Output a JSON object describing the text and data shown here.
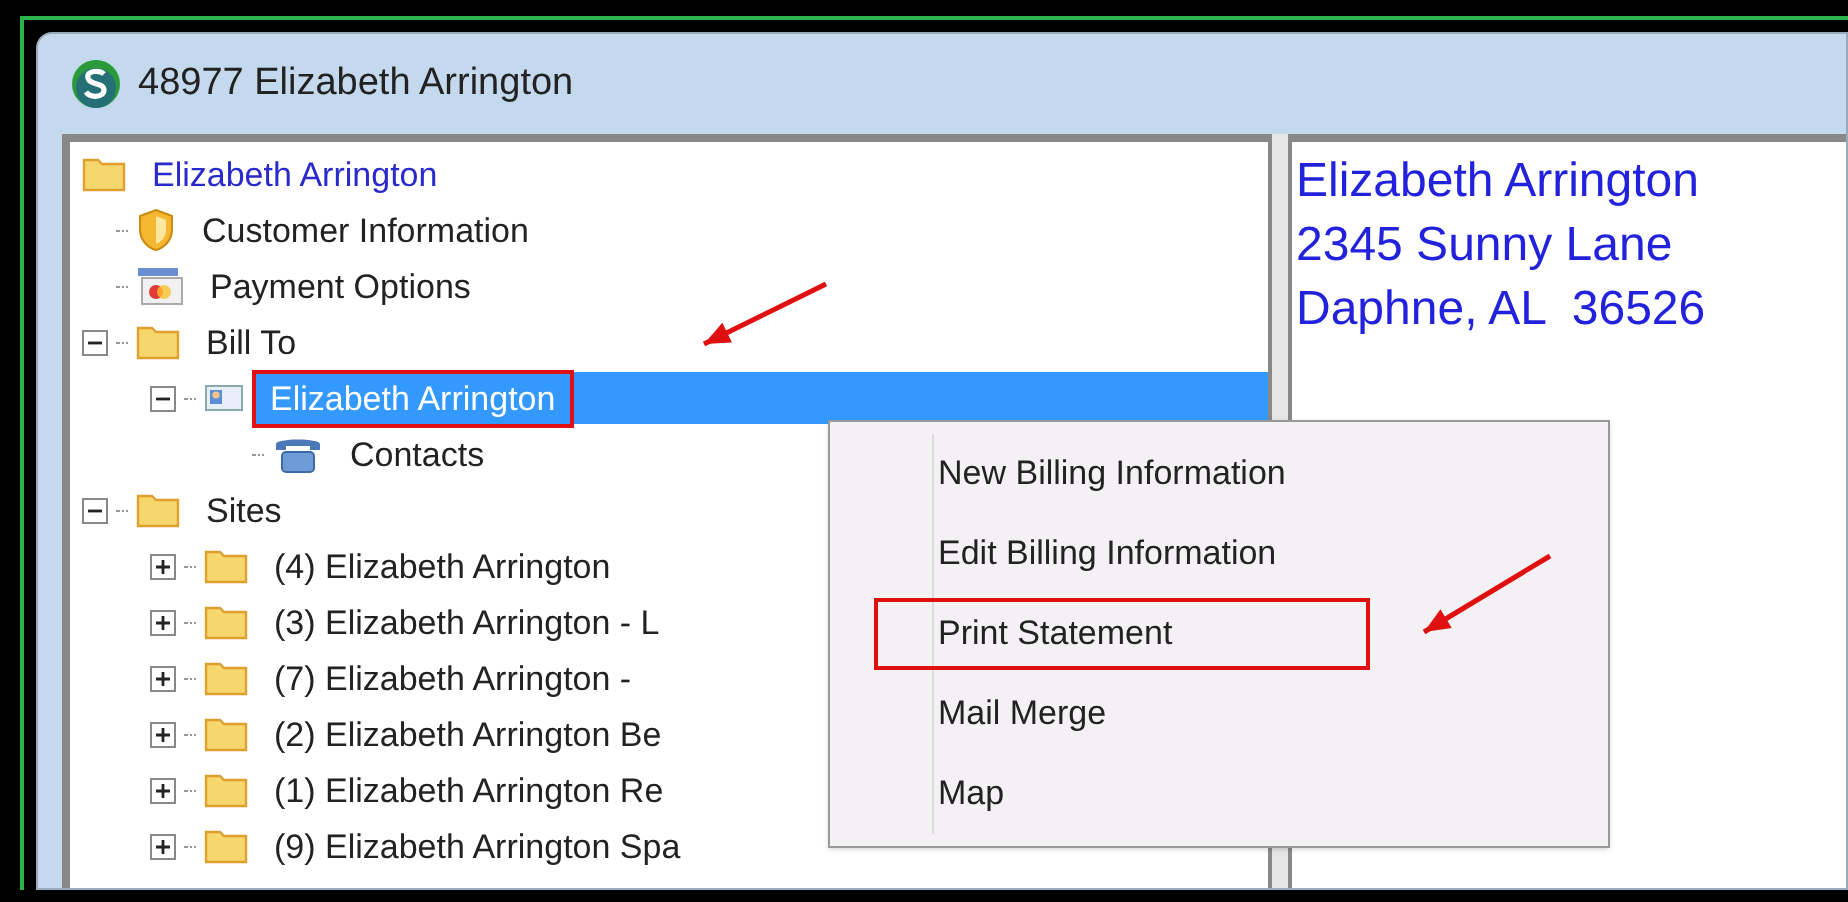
{
  "window": {
    "title": "48977 Elizabeth Arrington"
  },
  "tree": [
    {
      "label": "Elizabeth Arrington",
      "kind": "folder",
      "selected": false,
      "children": [
        {
          "label": "Customer Information",
          "kind": "shield",
          "selected": false
        },
        {
          "label": "Payment Options",
          "kind": "card",
          "selected": false
        },
        {
          "label": "Bill To",
          "kind": "folder",
          "expanded": true,
          "selected": false,
          "children": [
            {
              "label": "Elizabeth Arrington",
              "kind": "contact",
              "expanded": true,
              "selected": true,
              "annotated": true,
              "children": [
                {
                  "label": "Contacts",
                  "kind": "phone",
                  "selected": false
                }
              ]
            }
          ]
        },
        {
          "label": "Sites",
          "kind": "folder",
          "expanded": true,
          "selected": false,
          "children": [
            {
              "label": "(4) Elizabeth Arrington",
              "kind": "folder",
              "expanded": false,
              "selected": false
            },
            {
              "label": "(3) Elizabeth Arrington - L",
              "kind": "folder",
              "expanded": false,
              "selected": false
            },
            {
              "label": "(7) Elizabeth Arrington -",
              "kind": "folder",
              "expanded": false,
              "selected": false
            },
            {
              "label": "(2) Elizabeth Arrington Be",
              "kind": "folder",
              "expanded": false,
              "selected": false
            },
            {
              "label": "(1) Elizabeth Arrington Re",
              "kind": "folder",
              "expanded": false,
              "selected": false
            },
            {
              "label": "(9) Elizabeth Arrington Spa",
              "kind": "folder",
              "expanded": false,
              "selected": false
            }
          ]
        }
      ]
    }
  ],
  "address": [
    "Elizabeth Arrington",
    "2345 Sunny Lane",
    "Daphne, AL  36526"
  ],
  "context_menu": [
    {
      "label": "New Billing Information",
      "annotated": false
    },
    {
      "label": "Edit Billing Information",
      "annotated": false
    },
    {
      "label": "Print Statement",
      "annotated": true
    },
    {
      "label": "Mail Merge",
      "annotated": false
    },
    {
      "label": "Map",
      "annotated": false
    }
  ]
}
